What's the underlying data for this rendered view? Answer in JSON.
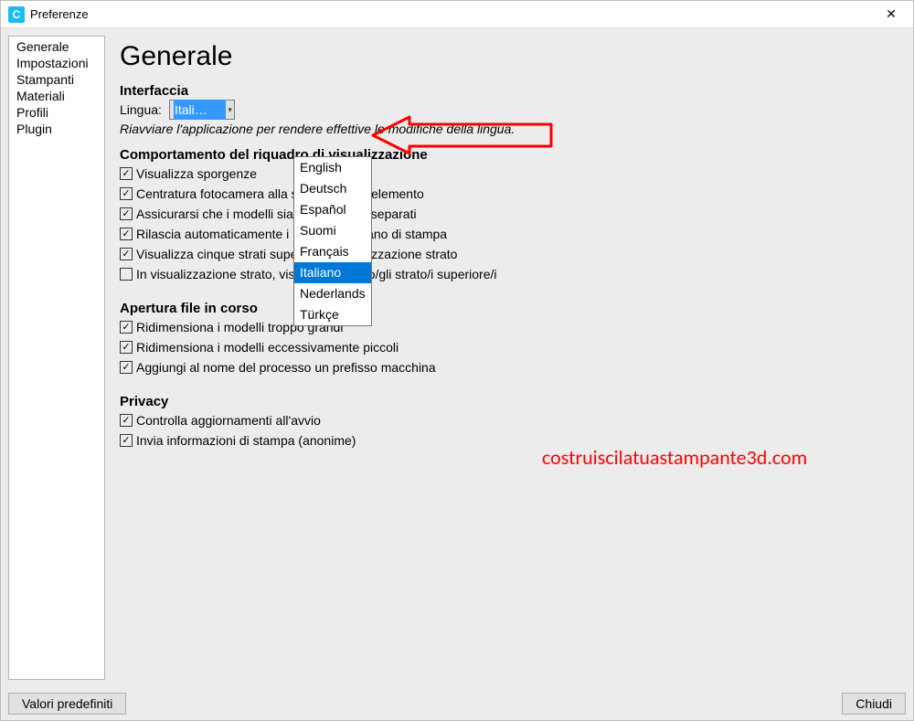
{
  "titlebar": {
    "title": "Preferenze"
  },
  "sidebar": {
    "items": [
      "Generale",
      "Impostazioni",
      "Stampanti",
      "Materiali",
      "Profili",
      "Plugin"
    ]
  },
  "main": {
    "title": "Generale",
    "interfaccia": {
      "header": "Interfaccia",
      "lingua_label": "Lingua:",
      "lingua_value": "Itali…",
      "hint": "Riavviare l'applicazione per rendere effettive le modifiche della lingua.",
      "options": [
        "English",
        "Deutsch",
        "Español",
        "Suomi",
        "Français",
        "Italiano",
        "Nederlands",
        "Türkçe"
      ],
      "selected": "Italiano"
    },
    "comportamento": {
      "header": "Comportamento del riquadro di visualizzazione",
      "items": [
        {
          "checked": true,
          "label": "Visualizza sporgenze"
        },
        {
          "checked": true,
          "label": "Centratura fotocamera alla selezione dell'elemento"
        },
        {
          "checked": true,
          "label": "Assicurarsi che i modelli siano mantenuti separati"
        },
        {
          "checked": true,
          "label": "Rilascia automaticamente i modelli sul piano di stampa"
        },
        {
          "checked": true,
          "label": "Visualizza cinque strati superiori in visualizzazione strato"
        },
        {
          "checked": false,
          "label": "In visualizzazione strato, visualizza solo lo/gli strato/i superiore/i"
        }
      ]
    },
    "apertura": {
      "header": "Apertura file in corso",
      "items": [
        {
          "checked": true,
          "label": "Ridimensiona i modelli troppo grandi"
        },
        {
          "checked": true,
          "label": "Ridimensiona i modelli eccessivamente piccoli"
        },
        {
          "checked": true,
          "label": "Aggiungi al nome del processo un prefisso macchina"
        }
      ]
    },
    "privacy": {
      "header": "Privacy",
      "items": [
        {
          "checked": true,
          "label": "Controlla aggiornamenti all'avvio"
        },
        {
          "checked": true,
          "label": "Invia informazioni di stampa (anonime)"
        }
      ]
    }
  },
  "footer": {
    "defaults": "Valori predefiniti",
    "close": "Chiudi"
  },
  "watermark": "costruiscilatuastampante3d.com"
}
